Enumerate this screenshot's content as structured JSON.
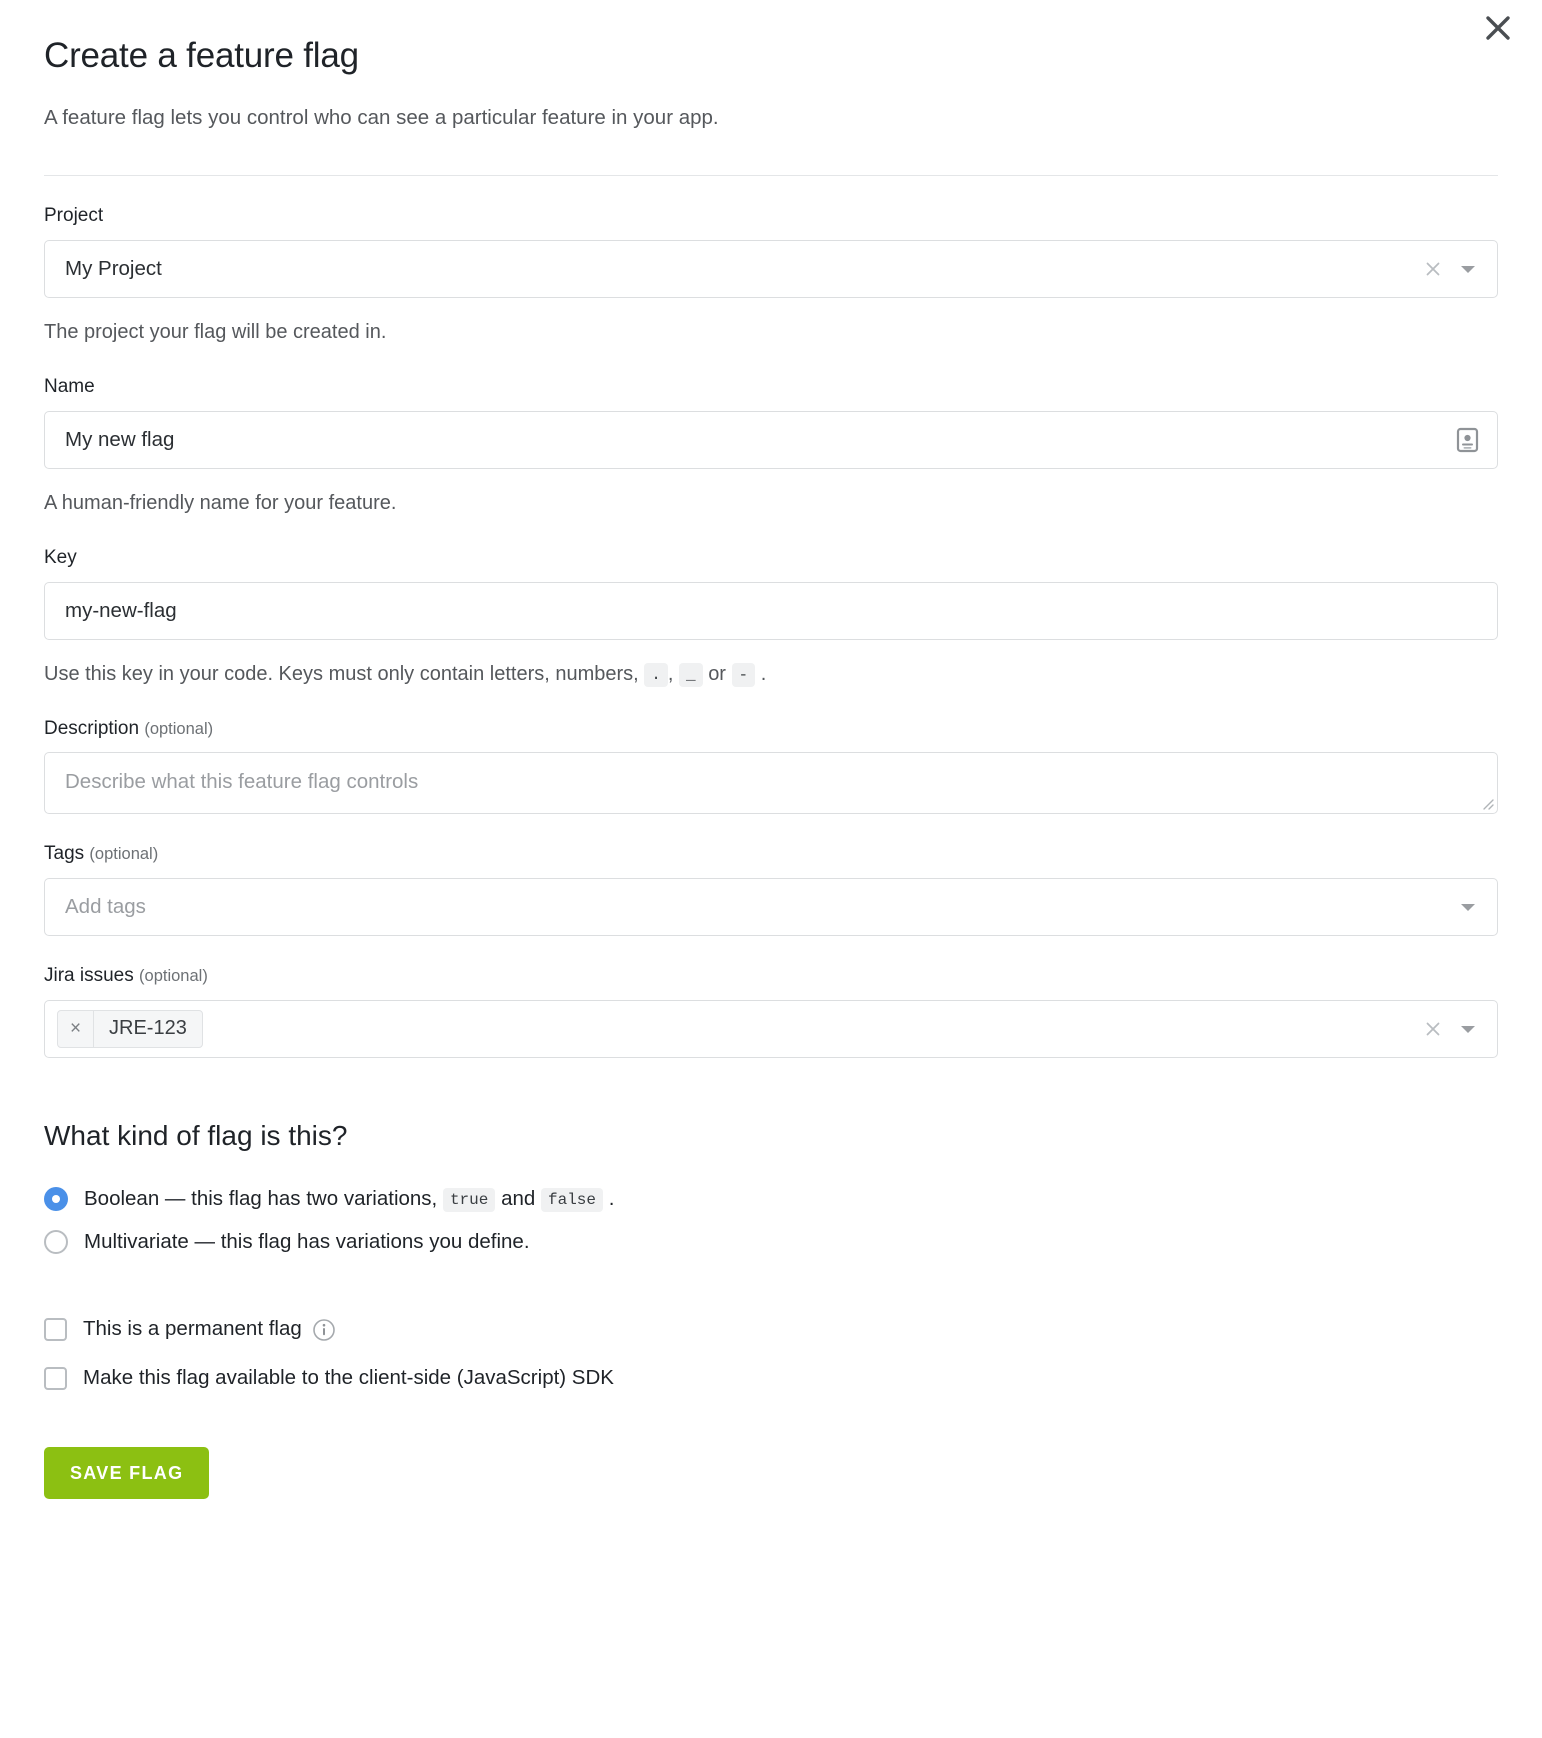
{
  "dialog": {
    "title": "Create a feature flag",
    "subtitle": "A feature flag lets you control who can see a particular feature in your app.",
    "close_icon": "close-icon"
  },
  "fields": {
    "project": {
      "label": "Project",
      "value": "My Project",
      "help": "The project your flag will be created in.",
      "clear_icon": "clear-icon",
      "dropdown_icon": "chevron-down-icon"
    },
    "name": {
      "label": "Name",
      "value": "My new flag",
      "help": "A human-friendly name for your feature.",
      "trailing_icon": "contact-card-icon"
    },
    "key": {
      "label": "Key",
      "value": "my-new-flag",
      "help_prefix": "Use this key in your code. Keys must only contain letters, numbers,",
      "chip_dot": ".",
      "help_comma": ",",
      "chip_underscore": "_",
      "help_or": "or",
      "chip_dash": "-",
      "help_period": "."
    },
    "description": {
      "label": "Description",
      "optional": "(optional)",
      "value": "",
      "placeholder": "Describe what this feature flag controls",
      "resize_icon": "resize-grip-icon"
    },
    "tags": {
      "label": "Tags",
      "optional": "(optional)",
      "value": "",
      "placeholder": "Add tags",
      "dropdown_icon": "chevron-down-icon"
    },
    "jira": {
      "label": "Jira issues",
      "optional": "(optional)",
      "tokens": [
        {
          "label": "JRE-123",
          "remove_icon": "remove-token-icon",
          "remove_glyph": "×"
        }
      ],
      "clear_icon": "clear-icon",
      "dropdown_icon": "chevron-down-icon"
    }
  },
  "flag_kind": {
    "heading": "What kind of flag is this?",
    "options": [
      {
        "selected": true,
        "prefix": "Boolean — this flag has two variations,",
        "chip_a": "true",
        "middle": "and",
        "chip_b": "false",
        "suffix": "."
      },
      {
        "selected": false,
        "prefix": "Multivariate — this flag has variations you define.",
        "chip_a": "",
        "middle": "",
        "chip_b": "",
        "suffix": ""
      }
    ]
  },
  "checkboxes": [
    {
      "label": "This is a permanent flag",
      "checked": false,
      "info_icon": "info-icon"
    },
    {
      "label": "Make this flag available to the client-side (JavaScript) SDK",
      "checked": false,
      "info_icon": ""
    }
  ],
  "actions": {
    "save_label": "SAVE FLAG"
  },
  "colors": {
    "accent_blue": "#4a90e8",
    "save_green": "#8cc012",
    "border": "#dcdee0",
    "muted_text": "#55585c"
  }
}
